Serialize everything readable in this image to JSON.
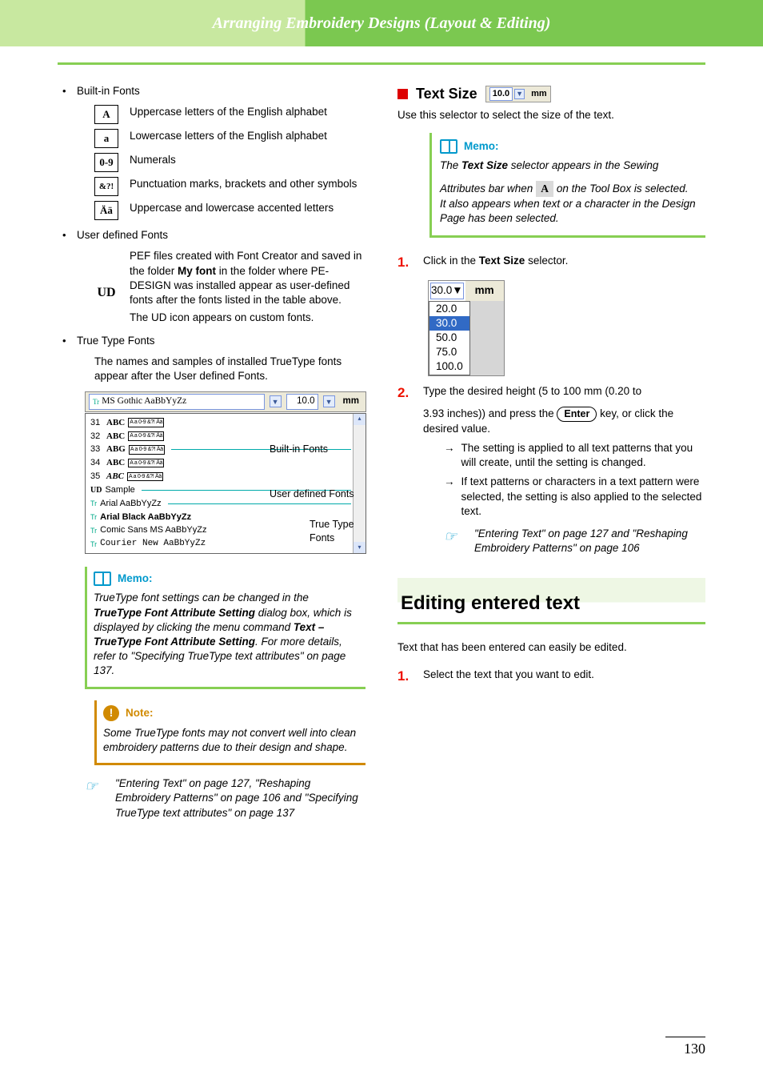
{
  "header_title": "Arranging Embroidery Designs (Layout & Editing)",
  "page_number": "130",
  "left": {
    "bullet_builtin": "Built-in Fonts",
    "icon_rows": [
      {
        "glyph": "A",
        "desc": "Uppercase letters of the English alphabet"
      },
      {
        "glyph": "a",
        "desc": "Lowercase letters of the English alphabet"
      },
      {
        "glyph": "0-9",
        "desc": "Numerals"
      },
      {
        "glyph": "&?!",
        "desc": "Punctuation marks, brackets and other symbols"
      },
      {
        "glyph": "Ää",
        "desc": "Uppercase and lowercase accented letters"
      }
    ],
    "bullet_user": "User defined Fonts",
    "ud_glyph": "UD",
    "ud_desc_pre": "PEF files created with Font Creator and saved in the folder ",
    "ud_desc_bold": "My font",
    "ud_desc_post": " in the folder where PE-DESIGN was installed appear as user-defined fonts after the fonts listed in the table above.",
    "ud_desc_line2": "The UD icon appears on custom fonts.",
    "bullet_tt": "True Type Fonts",
    "tt_desc": "The names and samples of installed TrueType fonts appear after the User defined Fonts.",
    "fontlist": {
      "top_sample": "MS Gothic  AaBbYyZz",
      "top_size": "10.0",
      "top_unit": "mm",
      "rows_builtin": [
        {
          "n": "31",
          "abc": "ABC"
        },
        {
          "n": "32",
          "abc": "ABC"
        },
        {
          "n": "33",
          "abc": "ABG"
        },
        {
          "n": "34",
          "abc": "ABC"
        },
        {
          "n": "35",
          "abc": "ABC",
          "italic": true
        }
      ],
      "row_ud": "Sample",
      "rows_tt": [
        "Arial  AaBbYyZz",
        "Arial Black  AaBbYyZz",
        "Comic Sans MS  AaBbYyZz",
        "Courier New  AaBbYyZz"
      ],
      "label_builtin": "Built-in Fonts",
      "label_user": "User defined Fonts",
      "label_tt": "True Type Fonts"
    },
    "memo_title": "Memo:",
    "memo_text_pre": "TrueType font settings can be changed in the ",
    "memo_bold1": "TrueType Font Attribute Setting",
    "memo_text_mid": " dialog box, which is displayed by clicking the menu command ",
    "memo_bold2": "Text – TrueType Font Attribute Setting",
    "memo_text_post": ". For more details, refer to \"Specifying TrueType text attributes\" on page 137.",
    "note_title": "Note:",
    "note_text": "Some TrueType fonts may not convert well into clean embroidery patterns due to their design and shape.",
    "ref_text": "\"Entering Text\" on page 127, \"Reshaping Embroidery Patterns\" on page 106 and \"Specifying TrueType text attributes\" on page 137"
  },
  "right": {
    "sec_title": "Text Size",
    "sec_selector_val": "10.0",
    "sec_selector_unit": "mm",
    "intro": "Use this selector to select the size of the text.",
    "memo_title": "Memo:",
    "memo_line1_pre": "The ",
    "memo_line1_bold": "Text Size",
    "memo_line1_post": " selector appears in the Sewing",
    "memo_line2_pre": "Attributes bar when ",
    "memo_line2_post": " on the Tool Box is selected. It also appears when text or a character in the Design Page has been selected.",
    "step1_pre": "Click in the ",
    "step1_bold": "Text Size",
    "step1_post": " selector.",
    "dropdown": {
      "selected": "30.0",
      "unit": "mm",
      "options": [
        "20.0",
        "30.0",
        "50.0",
        "75.0",
        "100.0"
      ]
    },
    "step2_line1": "Type the desired height (5 to 100 mm (0.20 to",
    "step2_line2_pre": "3.93 inches)) and press the ",
    "step2_key": "Enter",
    "step2_line2_post": " key, or click the desired value.",
    "sub1": "The setting is applied to all text patterns that you will create, until the setting is changed.",
    "sub2": "If text patterns or characters in a text pattern were selected, the setting is also applied to the selected text.",
    "ref_text": "\"Entering Text\" on page 127 and \"Reshaping Embroidery Patterns\" on page 106",
    "section_edit": "Editing entered text",
    "edit_intro": "Text that has been entered can easily be edited.",
    "edit_step1": "Select the text that you want to edit."
  }
}
